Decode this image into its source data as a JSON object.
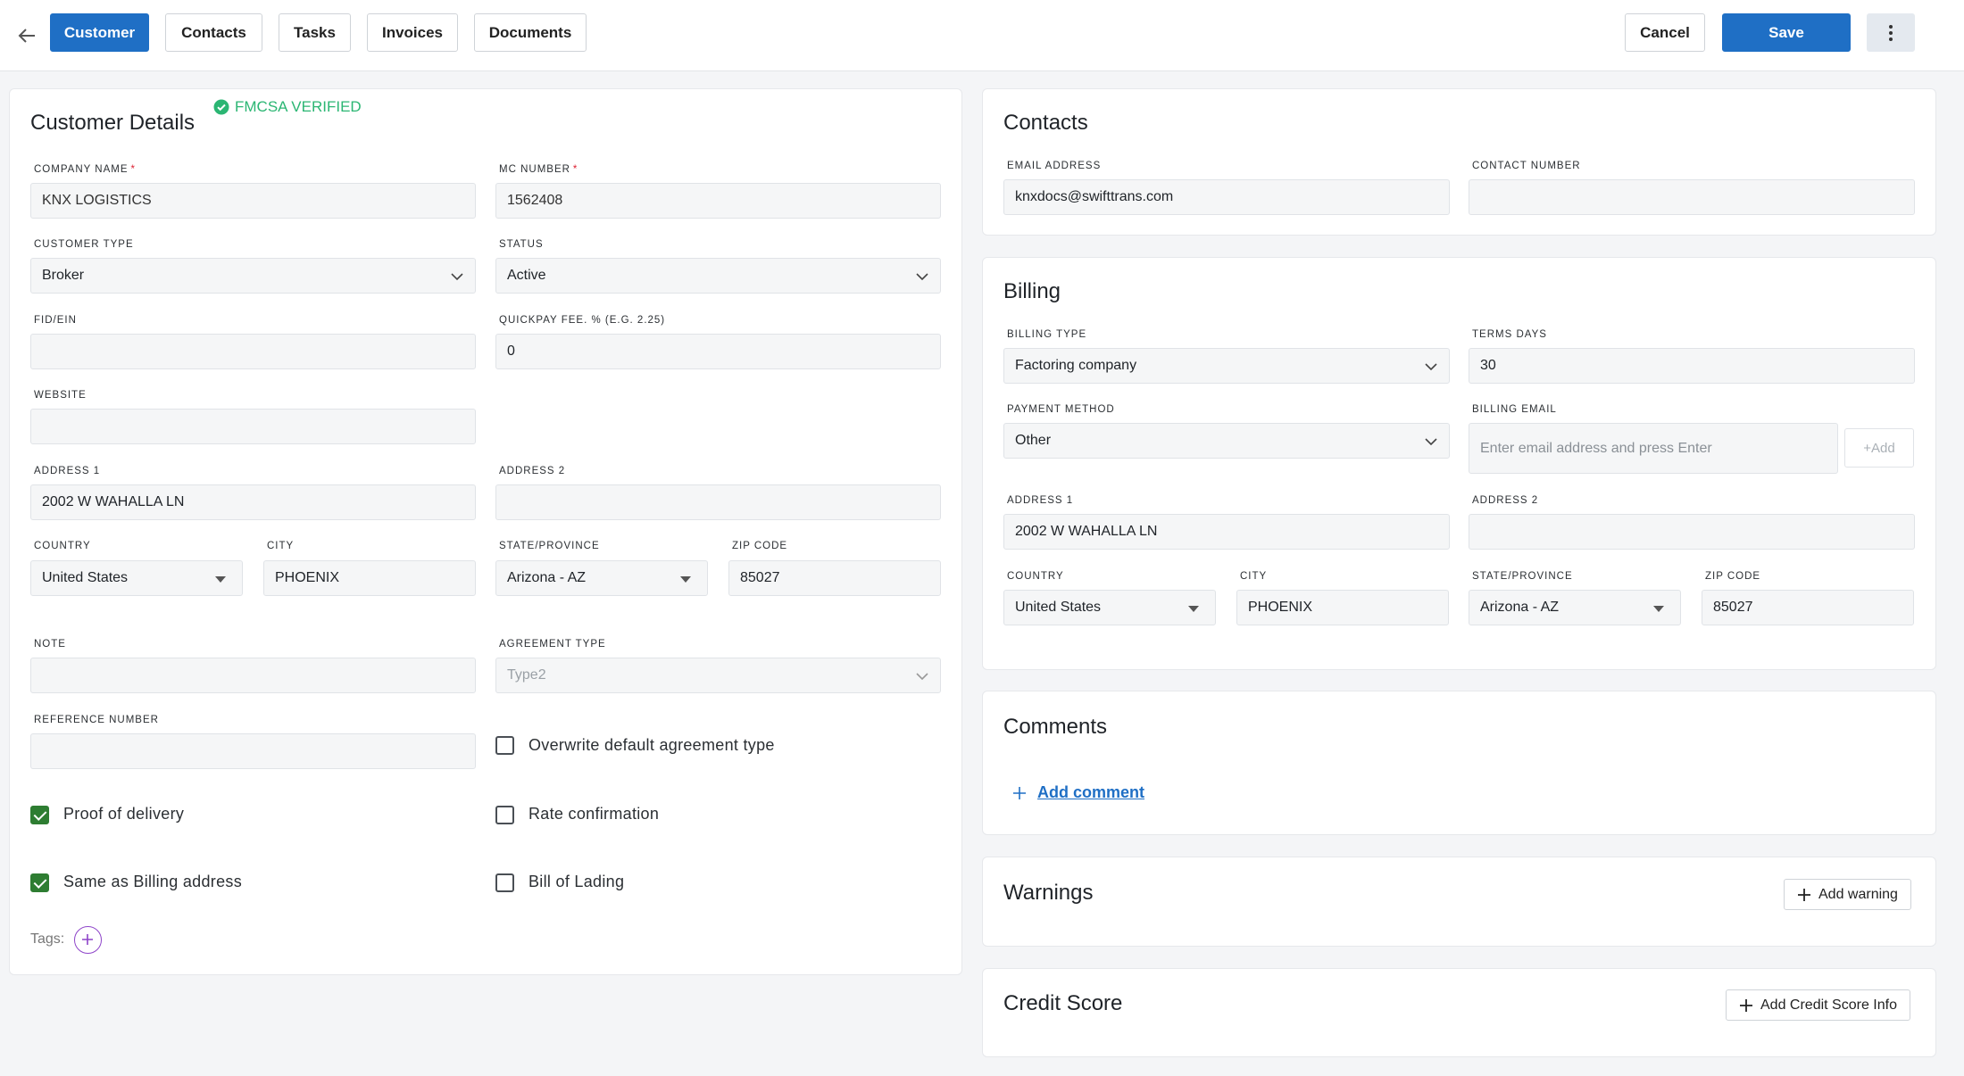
{
  "topbar": {
    "tabs": [
      "Customer",
      "Contacts",
      "Tasks",
      "Invoices",
      "Documents"
    ],
    "cancel_label": "Cancel",
    "save_label": "Save"
  },
  "customer": {
    "title": "Customer Details",
    "verified": "FMCSA VERIFIED",
    "company_name_label": "COMPANY NAME",
    "company_name": "KNX LOGISTICS",
    "mc_number_label": "MC NUMBER",
    "mc_number": "1562408",
    "customer_type_label": "CUSTOMER TYPE",
    "customer_type": "Broker",
    "status_label": "STATUS",
    "status": "Active",
    "fid_label": "FID/EIN",
    "fid": "",
    "quickpay_label": "QUICKPAY FEE. % (E.G. 2.25)",
    "quickpay": "0",
    "website_label": "WEBSITE",
    "website": "",
    "address1_label": "ADDRESS 1",
    "address1": "2002 W WAHALLA LN",
    "address2_label": "ADDRESS 2",
    "address2": "",
    "country_label": "COUNTRY",
    "country": "United States",
    "city_label": "CITY",
    "city": "PHOENIX",
    "state_label": "STATE/PROVINCE",
    "state": "Arizona - AZ",
    "zip_label": "ZIP CODE",
    "zip": "85027",
    "note_label": "NOTE",
    "note": "",
    "agreement_label": "AGREEMENT TYPE",
    "agreement": "Type2",
    "reference_label": "REFERENCE NUMBER",
    "reference": "",
    "overwrite_label": "Overwrite default agreement type",
    "pod_label": "Proof of delivery",
    "rate_label": "Rate confirmation",
    "same_billing_label": "Same as Billing address",
    "bol_label": "Bill of Lading",
    "tags_label": "Tags:"
  },
  "contacts": {
    "title": "Contacts",
    "email_label": "EMAIL ADDRESS",
    "email": "knxdocs@swifttrans.com",
    "phone_label": "CONTACT NUMBER",
    "phone": ""
  },
  "billing": {
    "title": "Billing",
    "type_label": "BILLING TYPE",
    "type": "Factoring company",
    "terms_label": "TERMS DAYS",
    "terms": "30",
    "payment_label": "PAYMENT METHOD",
    "payment": "Other",
    "email_label": "BILLING EMAIL",
    "email_placeholder": "Enter email address and press Enter",
    "add_label": "+Add",
    "address1_label": "ADDRESS 1",
    "address1": "2002 W WAHALLA LN",
    "address2_label": "ADDRESS 2",
    "address2": "",
    "country_label": "COUNTRY",
    "country": "United States",
    "city_label": "CITY",
    "city": "PHOENIX",
    "state_label": "STATE/PROVINCE",
    "state": "Arizona - AZ",
    "zip_label": "ZIP CODE",
    "zip": "85027"
  },
  "comments": {
    "title": "Comments",
    "add_label": "Add comment"
  },
  "warnings": {
    "title": "Warnings",
    "add_label": "Add warning"
  },
  "credit": {
    "title": "Credit Score",
    "add_label": "Add Credit Score Info"
  },
  "colors": {
    "primary": "#1f6fc5",
    "verified": "#2bb673",
    "checkbox": "#2e7d32",
    "tag_add": "#8e44c9"
  }
}
